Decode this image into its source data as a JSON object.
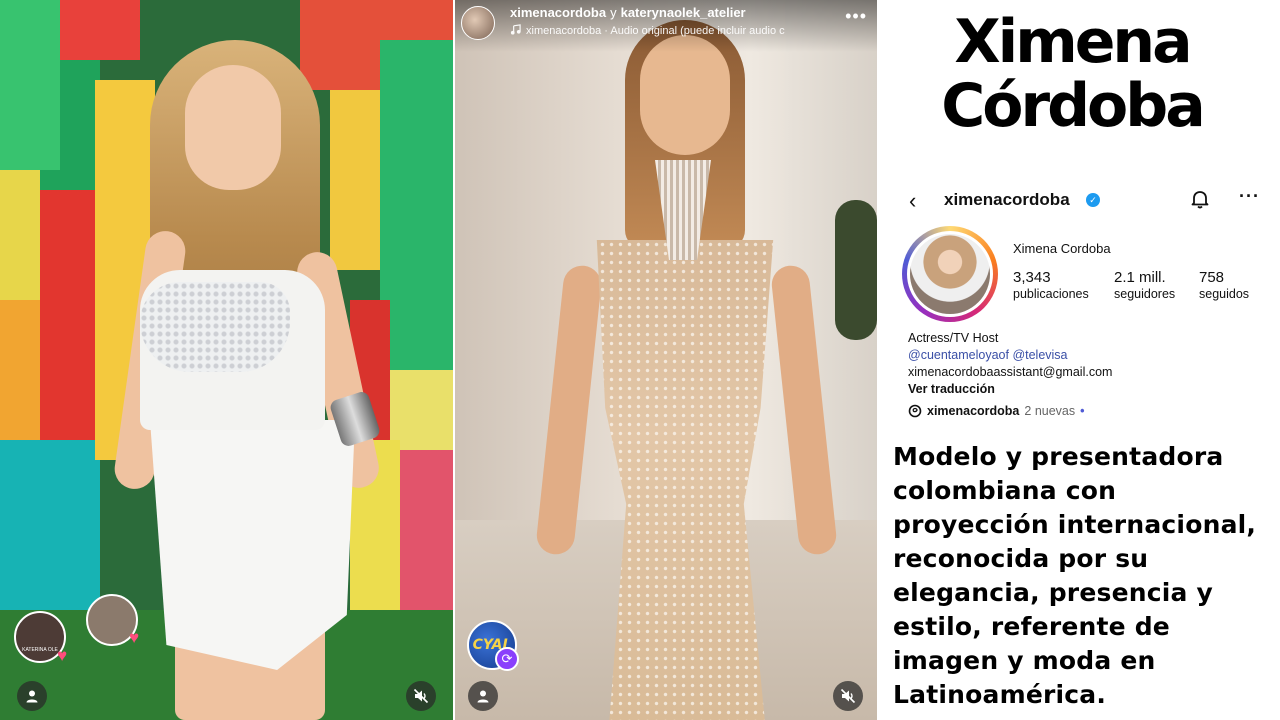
{
  "title": "Ximena Córdoba",
  "left_video": {
    "viewer_avatar_label": "KATERINA OLE"
  },
  "middle_video": {
    "user_primary": "ximenacordoba",
    "user_connector": "y",
    "user_secondary": "katerynaolek_atelier",
    "audio_text": "ximenacordoba · Audio original  (puede incluir audio c",
    "channel_logo_text": "CYAL"
  },
  "profile": {
    "username": "ximenacordoba",
    "display_name": "Ximena Cordoba",
    "stats": [
      {
        "value": "3,343",
        "label": "publicaciones"
      },
      {
        "value": "2.1 mill.",
        "label": "seguidores"
      },
      {
        "value": "758",
        "label": "seguidos"
      }
    ],
    "bio_role": "Actress/TV Host",
    "bio_mention_1": "@cuentameloyaof",
    "bio_mention_2": "@televisa",
    "bio_email": "ximenacordobaassistant@gmail.com",
    "translate_label": "Ver traducción",
    "threads_handle": "ximenacordoba",
    "threads_new": "2 nuevas",
    "threads_dot": "•"
  },
  "description": "Modelo y presentadora colombiana con proyección internacional, reconocida por su elegancia, presencia y estilo, referente de imagen y moda en Latinoamérica.",
  "colors": {
    "verified_blue": "#1d9bf0",
    "mention_blue": "#3a4fa6",
    "heart_pink": "#ff4d7d",
    "remix_purple": "#8a3ffc"
  },
  "icons": [
    "back-arrow-icon",
    "verified-icon",
    "bell-icon",
    "more-icon",
    "heart-icon",
    "person-icon",
    "mute-icon",
    "music-note-icon",
    "remix-icon",
    "threads-icon"
  ]
}
